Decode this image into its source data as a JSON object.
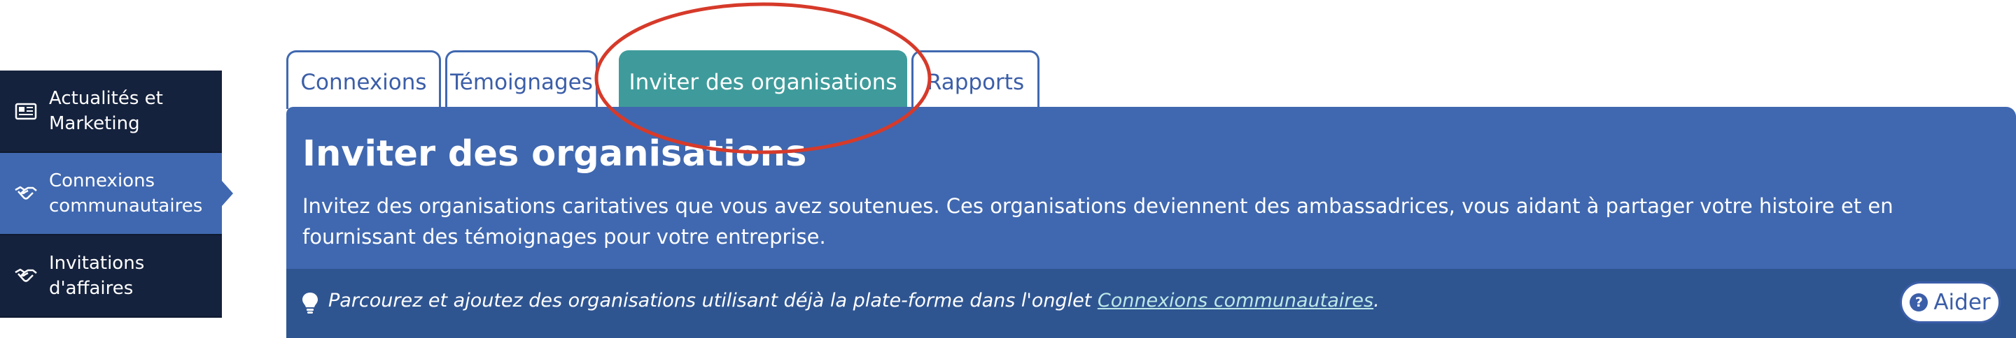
{
  "sidebar": {
    "items": [
      {
        "label": "Actualités et Marketing",
        "icon": "newspaper-icon",
        "active": false
      },
      {
        "label": "Connexions communautaires",
        "icon": "handshake-icon",
        "active": true
      },
      {
        "label": "Invitations d'affaires",
        "icon": "handshake-icon",
        "active": false
      }
    ]
  },
  "tabs": [
    {
      "label": "Connexions"
    },
    {
      "label": "Témoignages"
    },
    {
      "label": "Inviter des organisations",
      "active": true
    },
    {
      "label": "Rapports"
    }
  ],
  "panel": {
    "title": "Inviter des organisations",
    "description": "Invitez des organisations caritatives que vous avez soutenues. Ces organisations deviennent des ambassadrices, vous aidant à partager votre histoire et en fournissant des témoignages pour votre entreprise.",
    "info_prefix": "Parcourez et ajoutez des organisations utilisant déjà la plate-forme dans l'onglet ",
    "info_link": "Connexions communautaires",
    "info_suffix": ".",
    "help_label": "Aider"
  },
  "colors": {
    "sidebar_bg": "#15223d",
    "accent_blue": "#4068b0",
    "active_tab_teal": "#3f9b9b",
    "info_bar": "#2f5591",
    "annotation_red": "#d63a2a"
  }
}
